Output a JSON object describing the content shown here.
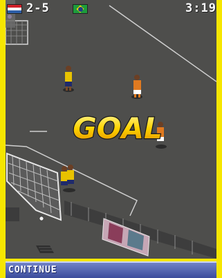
{
  "hud": {
    "home_flag_icon": "netherlands-flag-icon",
    "away_flag_icon": "brazil-flag-icon",
    "score": "2-5",
    "clock": "3:19"
  },
  "banner": {
    "text": "GOAL"
  },
  "softkeys": {
    "left_label": "CONTINUE"
  },
  "colors": {
    "frame": "#f6e600",
    "pitch": "#4e4e4c",
    "softkey_bar": "#5566b8"
  }
}
